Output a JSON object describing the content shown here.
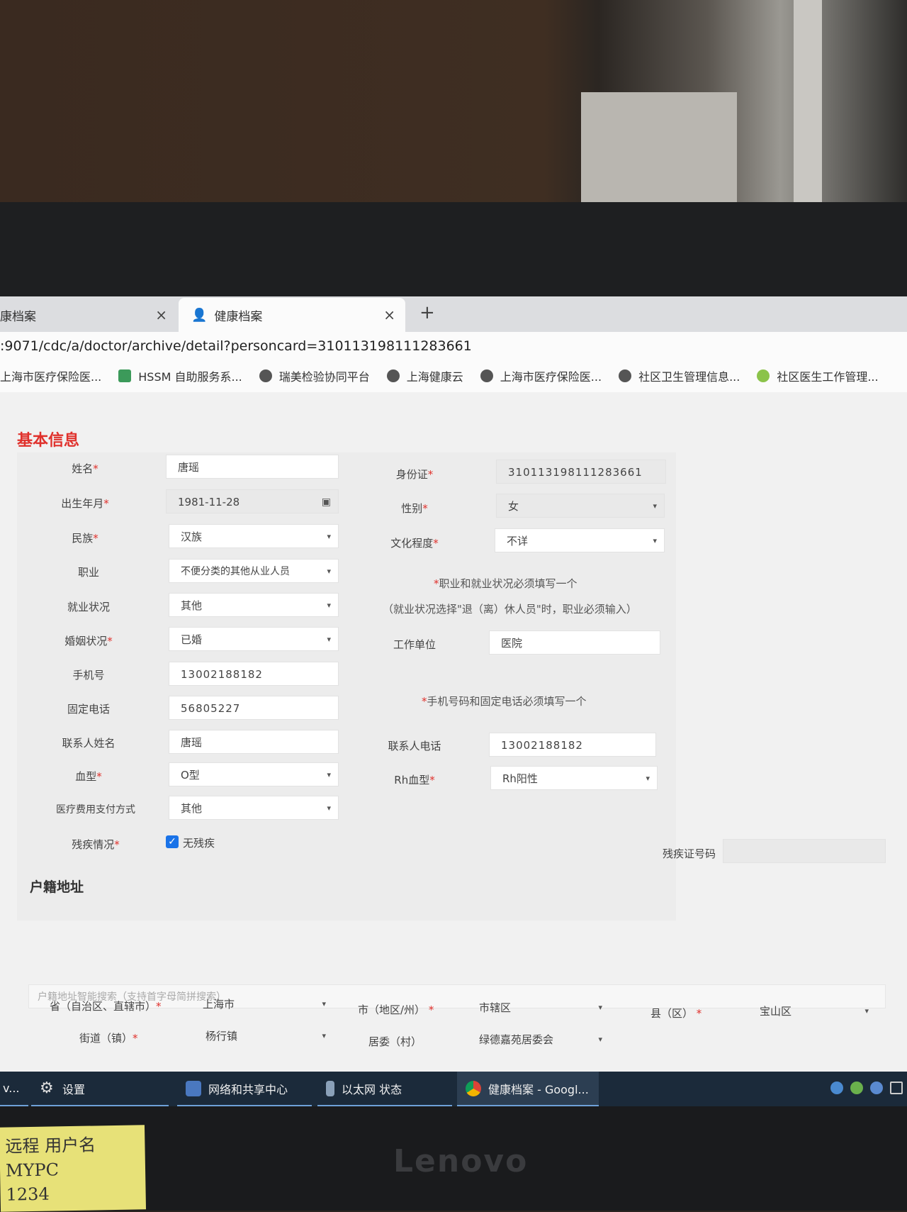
{
  "browser": {
    "tabs": [
      {
        "label": "康档案",
        "close": "×"
      },
      {
        "label": "健康档案",
        "close": "×"
      }
    ],
    "new_tab": "+",
    "url": ":9071/cdc/a/doctor/archive/detail?personcard=310113198111283661",
    "bookmarks": [
      "上海市医疗保险医...",
      "HSSM 自助服务系...",
      "瑞美检验协同平台",
      "上海健康云",
      "上海市医疗保险医...",
      "社区卫生管理信息...",
      "社区医生工作管理..."
    ]
  },
  "section_basic": "基本信息",
  "form": {
    "name": {
      "label": "姓名",
      "value": "唐瑶"
    },
    "id_card": {
      "label": "身份证",
      "value": "310113198111283661"
    },
    "birth": {
      "label": "出生年月",
      "value": "1981-11-28"
    },
    "gender": {
      "label": "性别",
      "value": "女"
    },
    "ethnicity": {
      "label": "民族",
      "value": "汉族"
    },
    "education": {
      "label": "文化程度",
      "value": "不详"
    },
    "occupation": {
      "label": "职业",
      "value": "不便分类的其他从业人员"
    },
    "employment": {
      "label": "就业状况",
      "value": "其他"
    },
    "hint_job_1": "职业和就业状况必须填写一个",
    "hint_job_2": "（就业状况选择\"退（离）休人员\"时，职业必须输入）",
    "marital": {
      "label": "婚姻状况",
      "value": "已婚"
    },
    "workplace": {
      "label": "工作单位",
      "value": "医院"
    },
    "mobile": {
      "label": "手机号",
      "value": "13002188182"
    },
    "landline": {
      "label": "固定电话",
      "value": "56805227"
    },
    "hint_phone": "手机号码和固定电话必须填写一个",
    "contact_name": {
      "label": "联系人姓名",
      "value": "唐瑶"
    },
    "contact_phone": {
      "label": "联系人电话",
      "value": "13002188182"
    },
    "blood": {
      "label": "血型",
      "value": "O型"
    },
    "rh": {
      "label": "Rh血型",
      "value": "Rh阳性"
    },
    "payment": {
      "label": "医疗费用支付方式",
      "value": "其他"
    },
    "disability": {
      "label": "残疾情况",
      "checkbox_label": "无残疾",
      "checked": true
    },
    "disability_no": {
      "label": "残疾证号码",
      "value": ""
    },
    "required_mark": "*",
    "caret": "▾",
    "checkmark": "✓"
  },
  "section_address": "户籍地址",
  "address": {
    "search_placeholder": "户籍地址智能搜索（支持首字母简拼搜索）",
    "province": {
      "label": "省（自治区、直辖市）",
      "value": "上海市"
    },
    "city": {
      "label": "市（地区/州）",
      "value": "市辖区"
    },
    "county": {
      "label": "县（区）",
      "value": "宝山区"
    },
    "street": {
      "label": "街道（镇）",
      "value": "杨行镇"
    },
    "committee": {
      "label": "居委（村）",
      "value": "绿德嘉苑居委会"
    }
  },
  "taskbar": {
    "items": [
      "v...",
      "设置",
      "网络和共享中心",
      "以太网 状态",
      "健康档案 - Googl..."
    ]
  },
  "bezel_brand": "Lenovo",
  "sticky_note": [
    "远程 用户名",
    "MYPC",
    "1234"
  ],
  "colors": {
    "required": "#e0312c",
    "checkbox": "#1a73e8",
    "taskbar": "#1b2a3a"
  }
}
